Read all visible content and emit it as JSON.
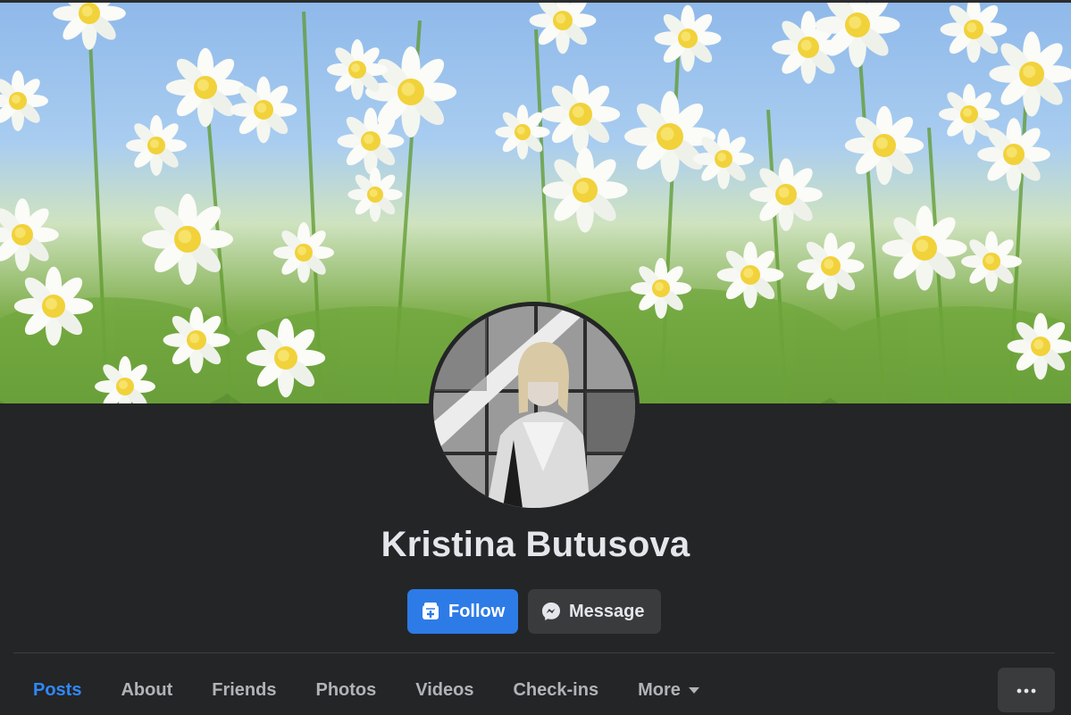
{
  "profile": {
    "name": "Kristina Butusova",
    "cover_alt": "daisy-field-cover-photo",
    "avatar_alt": "profile-photo"
  },
  "actions": {
    "follow_label": "Follow",
    "message_label": "Message"
  },
  "tabs": [
    {
      "label": "Posts",
      "active": true
    },
    {
      "label": "About",
      "active": false
    },
    {
      "label": "Friends",
      "active": false
    },
    {
      "label": "Photos",
      "active": false
    },
    {
      "label": "Videos",
      "active": false
    },
    {
      "label": "Check-ins",
      "active": false
    },
    {
      "label": "More",
      "active": false
    }
  ],
  "icons": {
    "follow": "follow-plus-icon",
    "message": "messenger-icon",
    "more_caret": "caret-down-icon",
    "overflow": "ellipsis-icon"
  },
  "colors": {
    "background": "#242526",
    "follow_button": "#2d7be6",
    "secondary_button": "#3a3b3c",
    "active_tab": "#2e89ff",
    "text": "#e4e6eb",
    "muted_text": "#b0b3b8"
  }
}
